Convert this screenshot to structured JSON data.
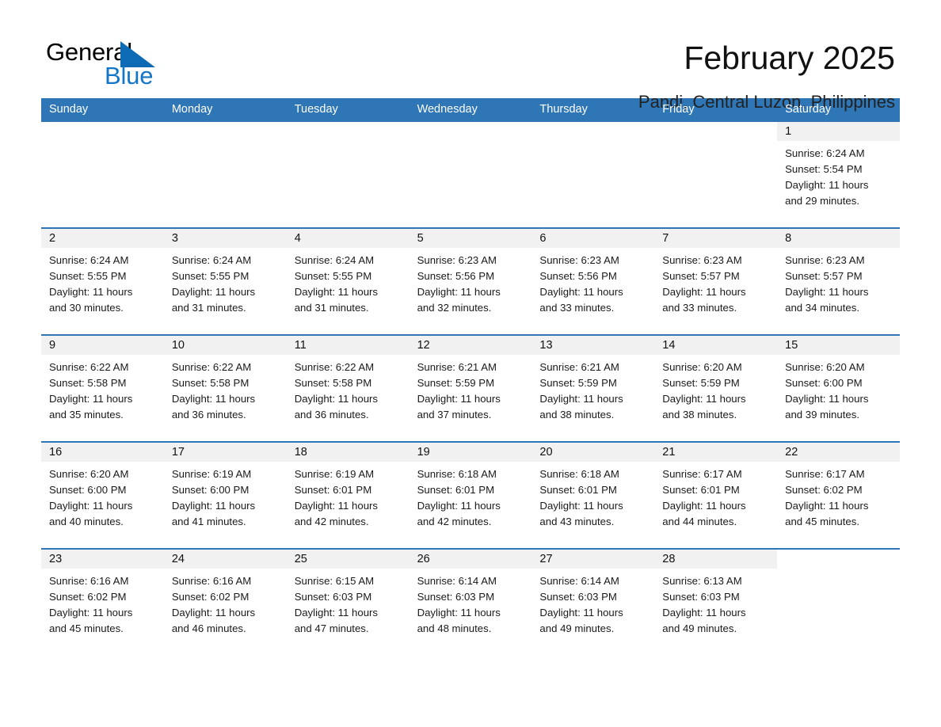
{
  "brand": {
    "name_part1": "General",
    "name_part2": "Blue",
    "triangle_icon": "triangle-icon",
    "blue": "#1476c6"
  },
  "header": {
    "month_title": "February 2025",
    "location": "Pandi, Central Luzon, Philippines"
  },
  "colors": {
    "header_bar": "#2f76b6",
    "row_divider": "#2f76b6",
    "daynum_band": "#f1f1f1",
    "text": "#1a1a1a"
  },
  "weekdays": [
    "Sunday",
    "Monday",
    "Tuesday",
    "Wednesday",
    "Thursday",
    "Friday",
    "Saturday"
  ],
  "weeks": [
    [
      {
        "day": "",
        "sunrise": "",
        "sunset": "",
        "daylight_line1": "",
        "daylight_line2": ""
      },
      {
        "day": "",
        "sunrise": "",
        "sunset": "",
        "daylight_line1": "",
        "daylight_line2": ""
      },
      {
        "day": "",
        "sunrise": "",
        "sunset": "",
        "daylight_line1": "",
        "daylight_line2": ""
      },
      {
        "day": "",
        "sunrise": "",
        "sunset": "",
        "daylight_line1": "",
        "daylight_line2": ""
      },
      {
        "day": "",
        "sunrise": "",
        "sunset": "",
        "daylight_line1": "",
        "daylight_line2": ""
      },
      {
        "day": "",
        "sunrise": "",
        "sunset": "",
        "daylight_line1": "",
        "daylight_line2": ""
      },
      {
        "day": "1",
        "sunrise": "Sunrise: 6:24 AM",
        "sunset": "Sunset: 5:54 PM",
        "daylight_line1": "Daylight: 11 hours",
        "daylight_line2": "and 29 minutes."
      }
    ],
    [
      {
        "day": "2",
        "sunrise": "Sunrise: 6:24 AM",
        "sunset": "Sunset: 5:55 PM",
        "daylight_line1": "Daylight: 11 hours",
        "daylight_line2": "and 30 minutes."
      },
      {
        "day": "3",
        "sunrise": "Sunrise: 6:24 AM",
        "sunset": "Sunset: 5:55 PM",
        "daylight_line1": "Daylight: 11 hours",
        "daylight_line2": "and 31 minutes."
      },
      {
        "day": "4",
        "sunrise": "Sunrise: 6:24 AM",
        "sunset": "Sunset: 5:55 PM",
        "daylight_line1": "Daylight: 11 hours",
        "daylight_line2": "and 31 minutes."
      },
      {
        "day": "5",
        "sunrise": "Sunrise: 6:23 AM",
        "sunset": "Sunset: 5:56 PM",
        "daylight_line1": "Daylight: 11 hours",
        "daylight_line2": "and 32 minutes."
      },
      {
        "day": "6",
        "sunrise": "Sunrise: 6:23 AM",
        "sunset": "Sunset: 5:56 PM",
        "daylight_line1": "Daylight: 11 hours",
        "daylight_line2": "and 33 minutes."
      },
      {
        "day": "7",
        "sunrise": "Sunrise: 6:23 AM",
        "sunset": "Sunset: 5:57 PM",
        "daylight_line1": "Daylight: 11 hours",
        "daylight_line2": "and 33 minutes."
      },
      {
        "day": "8",
        "sunrise": "Sunrise: 6:23 AM",
        "sunset": "Sunset: 5:57 PM",
        "daylight_line1": "Daylight: 11 hours",
        "daylight_line2": "and 34 minutes."
      }
    ],
    [
      {
        "day": "9",
        "sunrise": "Sunrise: 6:22 AM",
        "sunset": "Sunset: 5:58 PM",
        "daylight_line1": "Daylight: 11 hours",
        "daylight_line2": "and 35 minutes."
      },
      {
        "day": "10",
        "sunrise": "Sunrise: 6:22 AM",
        "sunset": "Sunset: 5:58 PM",
        "daylight_line1": "Daylight: 11 hours",
        "daylight_line2": "and 36 minutes."
      },
      {
        "day": "11",
        "sunrise": "Sunrise: 6:22 AM",
        "sunset": "Sunset: 5:58 PM",
        "daylight_line1": "Daylight: 11 hours",
        "daylight_line2": "and 36 minutes."
      },
      {
        "day": "12",
        "sunrise": "Sunrise: 6:21 AM",
        "sunset": "Sunset: 5:59 PM",
        "daylight_line1": "Daylight: 11 hours",
        "daylight_line2": "and 37 minutes."
      },
      {
        "day": "13",
        "sunrise": "Sunrise: 6:21 AM",
        "sunset": "Sunset: 5:59 PM",
        "daylight_line1": "Daylight: 11 hours",
        "daylight_line2": "and 38 minutes."
      },
      {
        "day": "14",
        "sunrise": "Sunrise: 6:20 AM",
        "sunset": "Sunset: 5:59 PM",
        "daylight_line1": "Daylight: 11 hours",
        "daylight_line2": "and 38 minutes."
      },
      {
        "day": "15",
        "sunrise": "Sunrise: 6:20 AM",
        "sunset": "Sunset: 6:00 PM",
        "daylight_line1": "Daylight: 11 hours",
        "daylight_line2": "and 39 minutes."
      }
    ],
    [
      {
        "day": "16",
        "sunrise": "Sunrise: 6:20 AM",
        "sunset": "Sunset: 6:00 PM",
        "daylight_line1": "Daylight: 11 hours",
        "daylight_line2": "and 40 minutes."
      },
      {
        "day": "17",
        "sunrise": "Sunrise: 6:19 AM",
        "sunset": "Sunset: 6:00 PM",
        "daylight_line1": "Daylight: 11 hours",
        "daylight_line2": "and 41 minutes."
      },
      {
        "day": "18",
        "sunrise": "Sunrise: 6:19 AM",
        "sunset": "Sunset: 6:01 PM",
        "daylight_line1": "Daylight: 11 hours",
        "daylight_line2": "and 42 minutes."
      },
      {
        "day": "19",
        "sunrise": "Sunrise: 6:18 AM",
        "sunset": "Sunset: 6:01 PM",
        "daylight_line1": "Daylight: 11 hours",
        "daylight_line2": "and 42 minutes."
      },
      {
        "day": "20",
        "sunrise": "Sunrise: 6:18 AM",
        "sunset": "Sunset: 6:01 PM",
        "daylight_line1": "Daylight: 11 hours",
        "daylight_line2": "and 43 minutes."
      },
      {
        "day": "21",
        "sunrise": "Sunrise: 6:17 AM",
        "sunset": "Sunset: 6:01 PM",
        "daylight_line1": "Daylight: 11 hours",
        "daylight_line2": "and 44 minutes."
      },
      {
        "day": "22",
        "sunrise": "Sunrise: 6:17 AM",
        "sunset": "Sunset: 6:02 PM",
        "daylight_line1": "Daylight: 11 hours",
        "daylight_line2": "and 45 minutes."
      }
    ],
    [
      {
        "day": "23",
        "sunrise": "Sunrise: 6:16 AM",
        "sunset": "Sunset: 6:02 PM",
        "daylight_line1": "Daylight: 11 hours",
        "daylight_line2": "and 45 minutes."
      },
      {
        "day": "24",
        "sunrise": "Sunrise: 6:16 AM",
        "sunset": "Sunset: 6:02 PM",
        "daylight_line1": "Daylight: 11 hours",
        "daylight_line2": "and 46 minutes."
      },
      {
        "day": "25",
        "sunrise": "Sunrise: 6:15 AM",
        "sunset": "Sunset: 6:03 PM",
        "daylight_line1": "Daylight: 11 hours",
        "daylight_line2": "and 47 minutes."
      },
      {
        "day": "26",
        "sunrise": "Sunrise: 6:14 AM",
        "sunset": "Sunset: 6:03 PM",
        "daylight_line1": "Daylight: 11 hours",
        "daylight_line2": "and 48 minutes."
      },
      {
        "day": "27",
        "sunrise": "Sunrise: 6:14 AM",
        "sunset": "Sunset: 6:03 PM",
        "daylight_line1": "Daylight: 11 hours",
        "daylight_line2": "and 49 minutes."
      },
      {
        "day": "28",
        "sunrise": "Sunrise: 6:13 AM",
        "sunset": "Sunset: 6:03 PM",
        "daylight_line1": "Daylight: 11 hours",
        "daylight_line2": "and 49 minutes."
      },
      {
        "day": "",
        "sunrise": "",
        "sunset": "",
        "daylight_line1": "",
        "daylight_line2": ""
      }
    ]
  ]
}
